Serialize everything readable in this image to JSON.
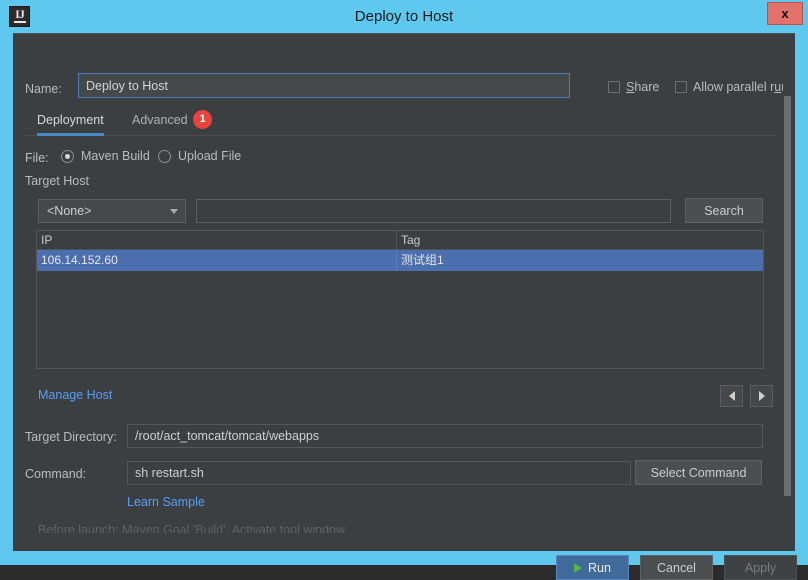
{
  "window": {
    "title": "Deploy to Host",
    "app_icon": "IJ",
    "close_label": "x",
    "border_color": "#5ec8ef",
    "body_bg": "#3c3f41"
  },
  "name_row": {
    "label": "Name:",
    "value": "Deploy to Host",
    "focus_border_color": "#4e7bbf",
    "share": {
      "label": "Share",
      "mnemonic": "S",
      "checked": false
    },
    "parallel": {
      "label": "Allow parallel run",
      "mnemonic": "u",
      "checked": false
    }
  },
  "tabs": [
    {
      "label": "Deployment",
      "selected": true
    },
    {
      "label": "Advanced",
      "selected": false
    }
  ],
  "tab_badge": {
    "count": "1",
    "color": "#e8433c"
  },
  "file_row": {
    "label": "File:",
    "options": [
      {
        "label": "Maven Build",
        "selected": true
      },
      {
        "label": "Upload File",
        "selected": false
      }
    ]
  },
  "target_host": {
    "section_label": "Target Host",
    "select_value": "<None>",
    "search_value": "",
    "search_button": "Search"
  },
  "host_table": {
    "columns": [
      "IP",
      "Tag"
    ],
    "rows": [
      {
        "ip": "106.14.152.60",
        "tag": "测试组1",
        "selected": true
      }
    ],
    "selection_color": "#4b6eaf"
  },
  "manage_host": {
    "label": "Manage Host",
    "link_color": "#589df6"
  },
  "nav": {
    "prev_icon": "triangle-left",
    "next_icon": "triangle-right"
  },
  "target_directory": {
    "label": "Target Directory:",
    "value": "/root/act_tomcat/tomcat/webapps"
  },
  "command": {
    "label": "Command:",
    "value": "sh restart.sh",
    "button": "Select Command",
    "learn_sample": "Learn Sample"
  },
  "before_launch": "Before launch: Maven Goal 'Build', Activate tool window",
  "footer": {
    "run": "Run",
    "cancel": "Cancel",
    "apply": "Apply",
    "run_bg": "#3f6a9a",
    "run_icon_color": "#51b34d",
    "apply_disabled": true
  }
}
